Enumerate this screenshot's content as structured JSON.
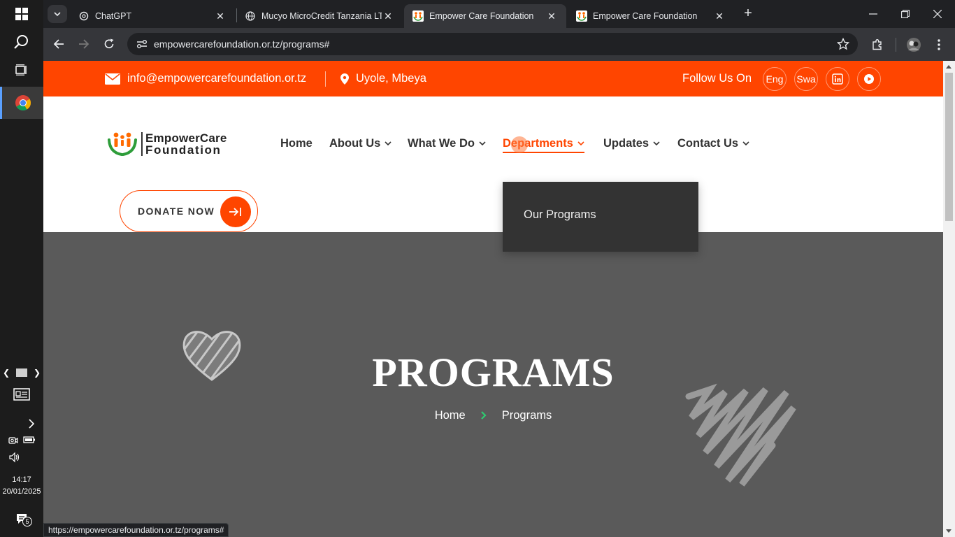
{
  "taskbar": {
    "clock_time": "14:17",
    "clock_date": "20/01/2025",
    "notification_count": "5"
  },
  "browser": {
    "tabs": [
      {
        "title": "ChatGPT",
        "active": false
      },
      {
        "title": "Mucyo MicroCredit Tanzania LTD",
        "active": false
      },
      {
        "title": "Empower Care Foundation",
        "active": true
      },
      {
        "title": "Empower Care Foundation",
        "active": false
      }
    ],
    "url": "empowercarefoundation.or.tz/programs#",
    "status_url": "https://empowercarefoundation.or.tz/programs#"
  },
  "topbar": {
    "email": "info@empowercarefoundation.or.tz",
    "location": "Uyole, Mbeya",
    "follow_label": "Follow Us On",
    "lang_en": "Eng",
    "lang_sw": "Swa"
  },
  "header": {
    "logo_line1": "EmpowerCare",
    "logo_line2": "Foundation",
    "menu": {
      "home": "Home",
      "about": "About Us",
      "what_we_do": "What We Do",
      "departments": "Departments",
      "updates": "Updates",
      "contact": "Contact Us"
    },
    "donate_label": "DONATE NOW",
    "dropdown_item": "Our Programs"
  },
  "hero": {
    "title": "PROGRAMS",
    "breadcrumb_home": "Home",
    "breadcrumb_current": "Programs"
  },
  "colors": {
    "brand_orange": "#ff4500",
    "breadcrumb_sep": "#2ecc71",
    "hero_bg": "#5a5a5a"
  }
}
